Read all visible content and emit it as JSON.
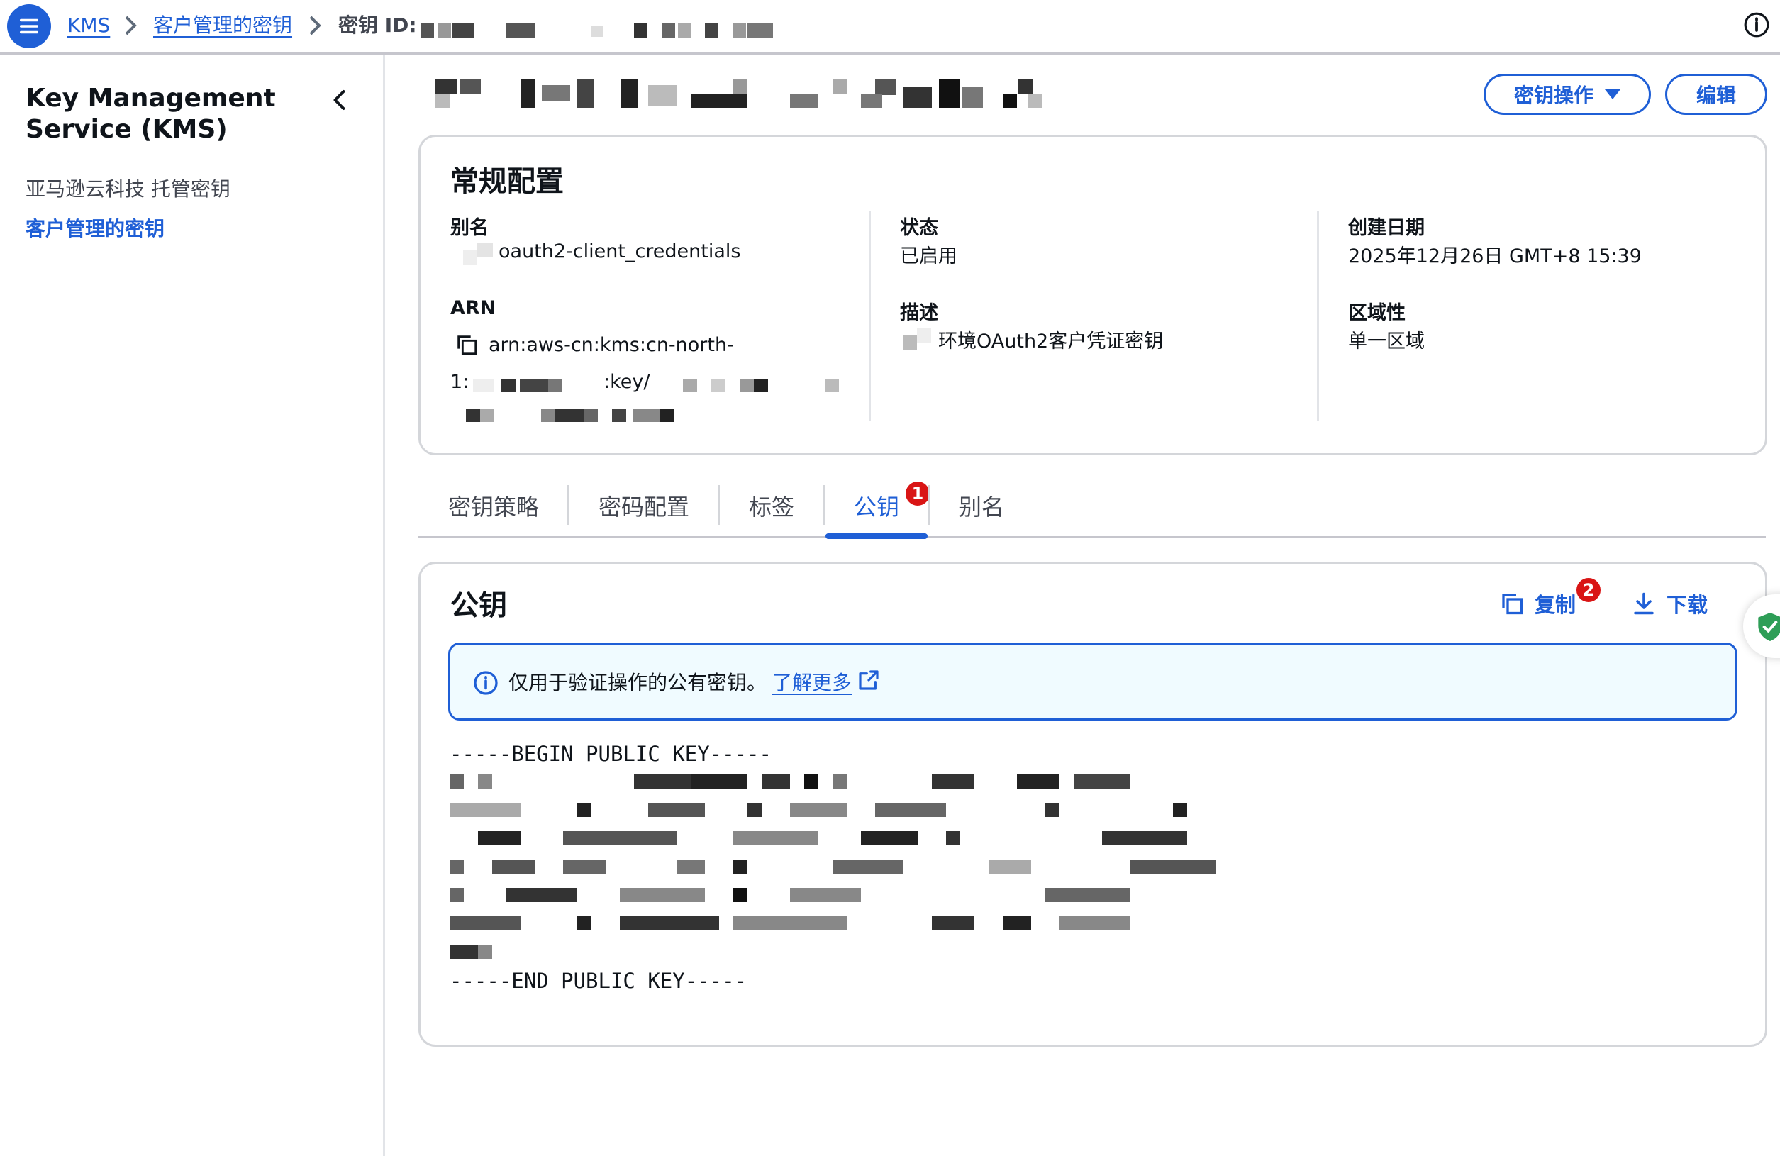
{
  "breadcrumb": {
    "root": "KMS",
    "parent": "客户管理的密钥",
    "current_label": "密钥 ID:"
  },
  "sidebar": {
    "title": "Key Management Service (KMS)",
    "items": [
      {
        "label": "亚马逊云科技 托管密钥",
        "selected": false
      },
      {
        "label": "客户管理的密钥",
        "selected": true
      }
    ]
  },
  "header": {
    "actions_button": "密钥操作",
    "edit_button": "编辑"
  },
  "general": {
    "title": "常规配置",
    "alias_label": "别名",
    "alias_value": "oauth2-client_credentials",
    "arn_label": "ARN",
    "arn_line1": "arn:aws-cn:kms:cn-north-",
    "arn_line2_prefix": "1:",
    "arn_line2_mid": ":key/",
    "status_label": "状态",
    "status_value": "已启用",
    "description_label": "描述",
    "description_value": "环境OAuth2客户凭证密钥",
    "created_label": "创建日期",
    "created_value": "2025年12月26日 GMT+8 15:39",
    "regionality_label": "区域性",
    "regionality_value": "单一区域"
  },
  "tabs": [
    {
      "label": "密钥策略",
      "active": false
    },
    {
      "label": "密码配置",
      "active": false
    },
    {
      "label": "标签",
      "active": false
    },
    {
      "label": "公钥",
      "active": true,
      "badge": "1"
    },
    {
      "label": "别名",
      "active": false
    }
  ],
  "public_key": {
    "title": "公钥",
    "copy_label": "复制",
    "copy_badge": "2",
    "download_label": "下载",
    "info_text": "仅用于验证操作的公有密钥。",
    "learn_more": "了解更多",
    "begin_line": "-----BEGIN PUBLIC KEY-----",
    "end_line": "-----END PUBLIC KEY-----"
  },
  "colors": {
    "accent": "#1f5fd6",
    "badge": "#d91515",
    "info_bg": "#f0fbff",
    "border": "#d4d6da"
  },
  "icons": [
    "menu-icon",
    "chevron-right-icon",
    "info-icon",
    "chevron-left-icon",
    "caret-down-icon",
    "copy-icon",
    "download-icon",
    "external-link-icon",
    "shield-check-icon"
  ]
}
